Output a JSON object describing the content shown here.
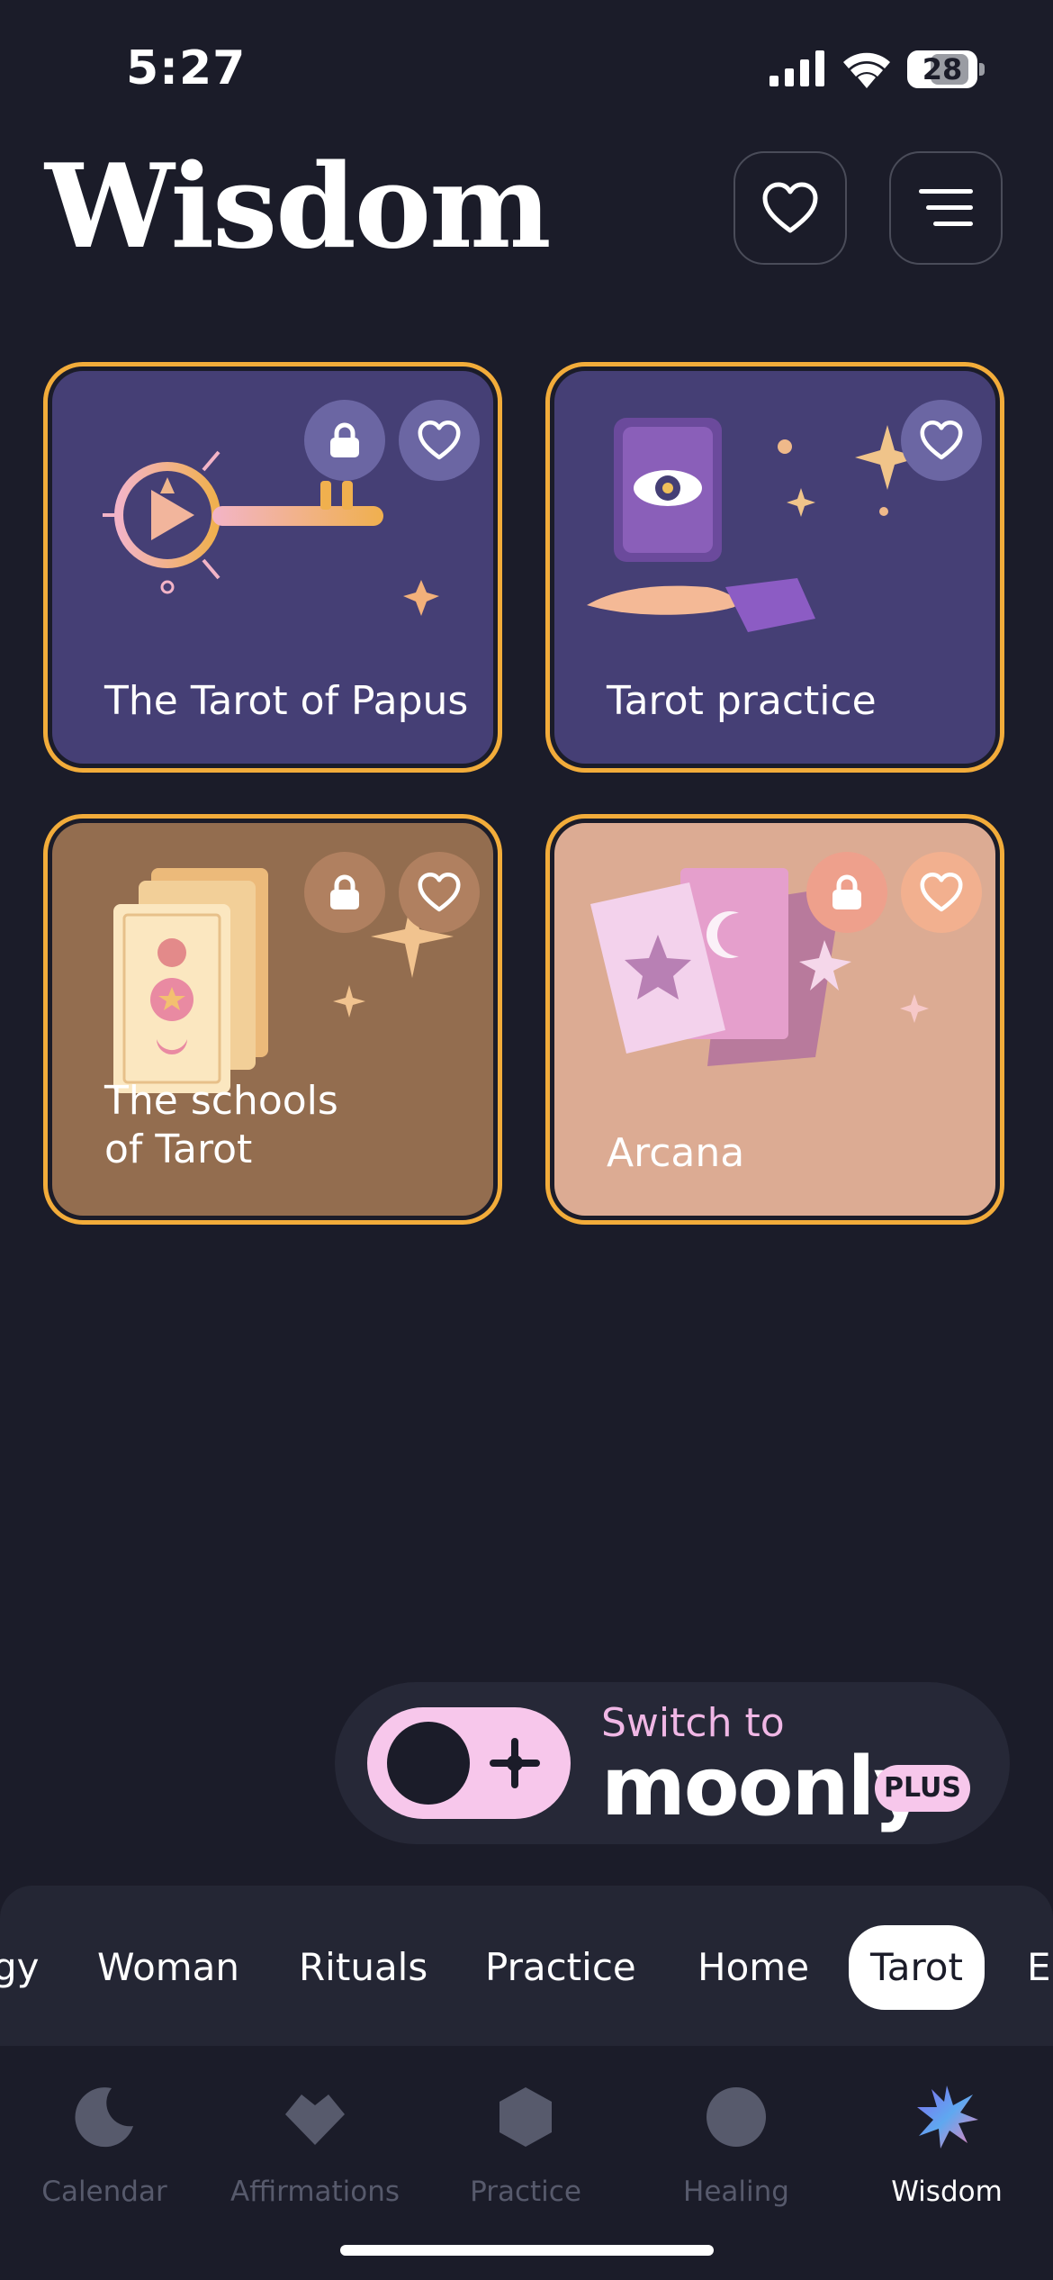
{
  "status_bar": {
    "time": "5:27",
    "battery": "28"
  },
  "header": {
    "title": "Wisdom",
    "favorites_icon": "heart-outline-icon",
    "menu_icon": "hamburger-menu-icon"
  },
  "cards": [
    {
      "title": "The Tarot of Papus",
      "locked": true,
      "bg": "#453f75"
    },
    {
      "title": "Tarot practice",
      "locked": false,
      "bg": "#453f75"
    },
    {
      "title": "The schools of Tarot",
      "title_line1": "The schools",
      "title_line2": "of Tarot",
      "locked": true,
      "bg": "#936d4f"
    },
    {
      "title": "Arcana",
      "locked": true,
      "bg": "#dcab93"
    }
  ],
  "card_border_color": "#f2ac3a",
  "promo": {
    "switch_text": "Switch to",
    "brand": "moonly",
    "badge": "PLUS"
  },
  "categories": [
    "gy",
    "Woman",
    "Rituals",
    "Practice",
    "Home",
    "Tarot",
    "En"
  ],
  "active_category": "Tarot",
  "tabs": [
    {
      "label": "Calendar",
      "icon": "moon-icon"
    },
    {
      "label": "Affirmations",
      "icon": "heart-icon"
    },
    {
      "label": "Practice",
      "icon": "hexagon-icon"
    },
    {
      "label": "Healing",
      "icon": "circle-icon"
    },
    {
      "label": "Wisdom",
      "icon": "star-burst-icon"
    }
  ],
  "active_tab": "Wisdom"
}
